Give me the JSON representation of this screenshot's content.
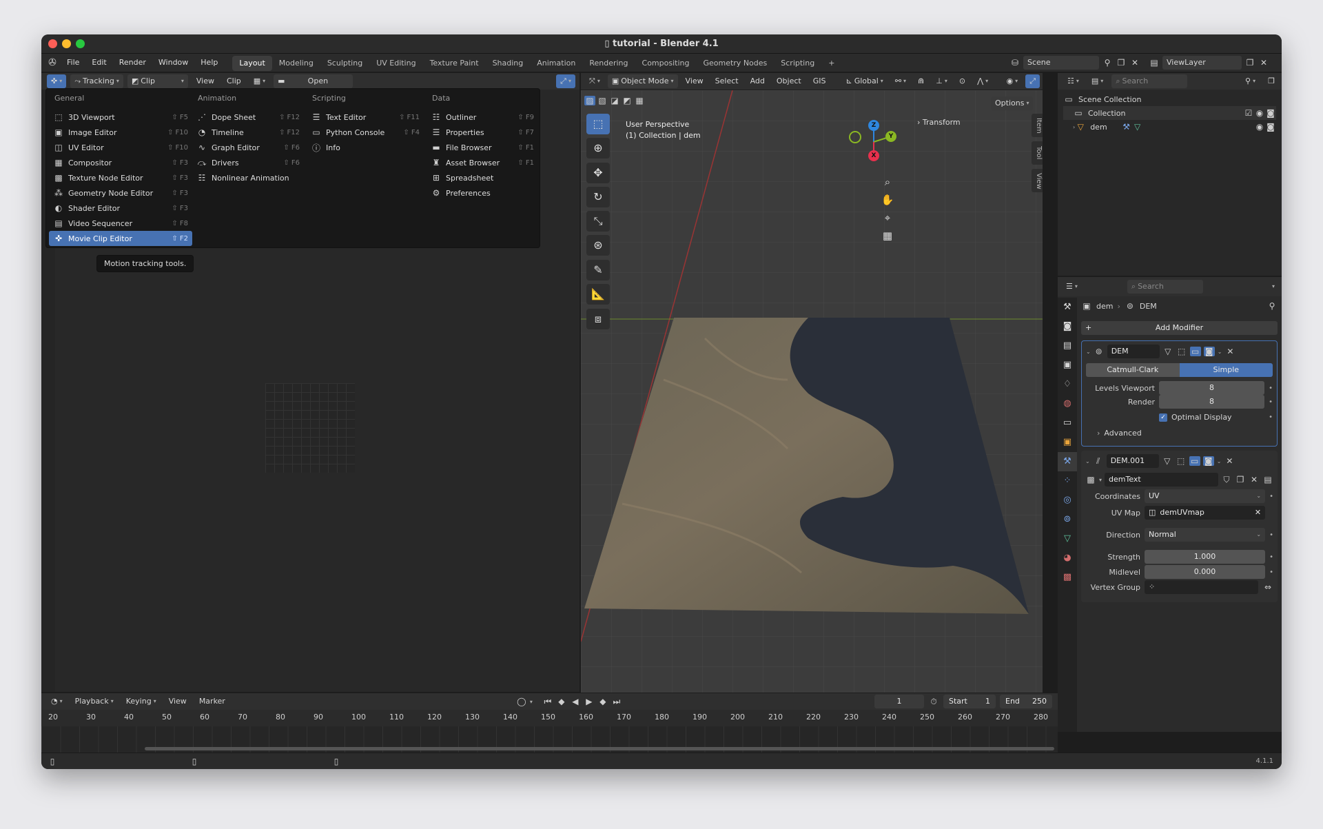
{
  "window": {
    "title": "tutorial - Blender 4.1",
    "version": "4.1.1"
  },
  "menubar": {
    "items": [
      "File",
      "Edit",
      "Render",
      "Window",
      "Help"
    ],
    "workspaces": [
      "Layout",
      "Modeling",
      "Sculpting",
      "UV Editing",
      "Texture Paint",
      "Shading",
      "Animation",
      "Rendering",
      "Compositing",
      "Geometry Nodes",
      "Scripting"
    ],
    "active_workspace": "Layout",
    "add_tab": "+",
    "scene": "Scene",
    "view_layer": "ViewLayer"
  },
  "clip_header": {
    "mode": "Tracking",
    "clip": "Clip",
    "view": "View",
    "clip_menu": "Clip",
    "open": "Open"
  },
  "editor_menu": {
    "columns": [
      {
        "title": "General",
        "items": [
          {
            "label": "3D Viewport",
            "shortcut": "⇧ F5",
            "icon": "cube-icon"
          },
          {
            "label": "Image Editor",
            "shortcut": "⇧ F10",
            "icon": "image-icon"
          },
          {
            "label": "UV Editor",
            "shortcut": "⇧ F10",
            "icon": "uv-icon"
          },
          {
            "label": "Compositor",
            "shortcut": "⇧ F3",
            "icon": "compositor-icon"
          },
          {
            "label": "Texture Node Editor",
            "shortcut": "⇧ F3",
            "icon": "texture-icon"
          },
          {
            "label": "Geometry Node Editor",
            "shortcut": "⇧ F3",
            "icon": "geometry-nodes-icon"
          },
          {
            "label": "Shader Editor",
            "shortcut": "⇧ F3",
            "icon": "shader-icon"
          },
          {
            "label": "Video Sequencer",
            "shortcut": "⇧ F8",
            "icon": "sequencer-icon"
          },
          {
            "label": "Movie Clip Editor",
            "shortcut": "⇧ F2",
            "icon": "movie-clip-icon"
          }
        ]
      },
      {
        "title": "Animation",
        "items": [
          {
            "label": "Dope Sheet",
            "shortcut": "⇧ F12",
            "icon": "dope-sheet-icon"
          },
          {
            "label": "Timeline",
            "shortcut": "⇧ F12",
            "icon": "timeline-icon"
          },
          {
            "label": "Graph Editor",
            "shortcut": "⇧ F6",
            "icon": "graph-icon"
          },
          {
            "label": "Drivers",
            "shortcut": "⇧ F6",
            "icon": "drivers-icon"
          },
          {
            "label": "Nonlinear Animation",
            "shortcut": "",
            "icon": "nla-icon"
          }
        ]
      },
      {
        "title": "Scripting",
        "items": [
          {
            "label": "Text Editor",
            "shortcut": "⇧ F11",
            "icon": "text-icon"
          },
          {
            "label": "Python Console",
            "shortcut": "⇧ F4",
            "icon": "console-icon"
          },
          {
            "label": "Info",
            "shortcut": "",
            "icon": "info-icon"
          }
        ]
      },
      {
        "title": "Data",
        "items": [
          {
            "label": "Outliner",
            "shortcut": "⇧ F9",
            "icon": "outliner-icon"
          },
          {
            "label": "Properties",
            "shortcut": "⇧ F7",
            "icon": "properties-icon"
          },
          {
            "label": "File Browser",
            "shortcut": "⇧ F1",
            "icon": "folder-icon"
          },
          {
            "label": "Asset Browser",
            "shortcut": "⇧ F1",
            "icon": "asset-icon"
          },
          {
            "label": "Spreadsheet",
            "shortcut": "",
            "icon": "spreadsheet-icon"
          },
          {
            "label": "Preferences",
            "shortcut": "",
            "icon": "gear-icon"
          }
        ]
      }
    ],
    "tooltip": "Motion tracking tools."
  },
  "viewport": {
    "mode": "Object Mode",
    "menus": [
      "View",
      "Select",
      "Add",
      "Object",
      "GIS"
    ],
    "orientation": "Global",
    "options": "Options",
    "perspective": "User Perspective",
    "collection_info": "(1) Collection | dem",
    "transform_panel": "Transform",
    "side_tabs": [
      "Item",
      "Tool",
      "View"
    ],
    "gizmo": {
      "z": "Z",
      "y": "Y",
      "x": "X"
    }
  },
  "outliner": {
    "search_placeholder": "Search",
    "scene_collection": "Scene Collection",
    "collection": "Collection",
    "object": "dem"
  },
  "properties": {
    "search_placeholder": "Search",
    "breadcrumb_object": "dem",
    "breadcrumb_modifier": "DEM",
    "add_modifier": "Add Modifier",
    "subsurf": {
      "name": "DEM",
      "type_a": "Catmull-Clark",
      "type_b": "Simple",
      "levels_viewport_label": "Levels Viewport",
      "levels_viewport": "8",
      "render_label": "Render",
      "render": "8",
      "optimal_display": "Optimal Display",
      "advanced": "Advanced"
    },
    "displace": {
      "name": "DEM.001",
      "texture": "demText",
      "coordinates_label": "Coordinates",
      "coordinates": "UV",
      "uvmap_label": "UV Map",
      "uvmap": "demUVmap",
      "direction_label": "Direction",
      "direction": "Normal",
      "strength_label": "Strength",
      "strength": "1.000",
      "midlevel_label": "Midlevel",
      "midlevel": "0.000",
      "vertex_group_label": "Vertex Group"
    }
  },
  "timeline": {
    "menus": [
      "Playback",
      "Keying",
      "View",
      "Marker"
    ],
    "current_frame": "1",
    "start_label": "Start",
    "start": "1",
    "end_label": "End",
    "end": "250",
    "ticks": [
      "20",
      "30",
      "40",
      "50",
      "60",
      "70",
      "80",
      "90",
      "100",
      "110",
      "120",
      "130",
      "140",
      "150",
      "160",
      "170",
      "180",
      "190",
      "200",
      "210",
      "220",
      "230",
      "240",
      "250",
      "260",
      "270",
      "280"
    ]
  },
  "colors": {
    "accent": "#4772b3",
    "x_axis": "#e8304d",
    "y_axis": "#8bb823",
    "z_axis": "#2e87e0"
  }
}
